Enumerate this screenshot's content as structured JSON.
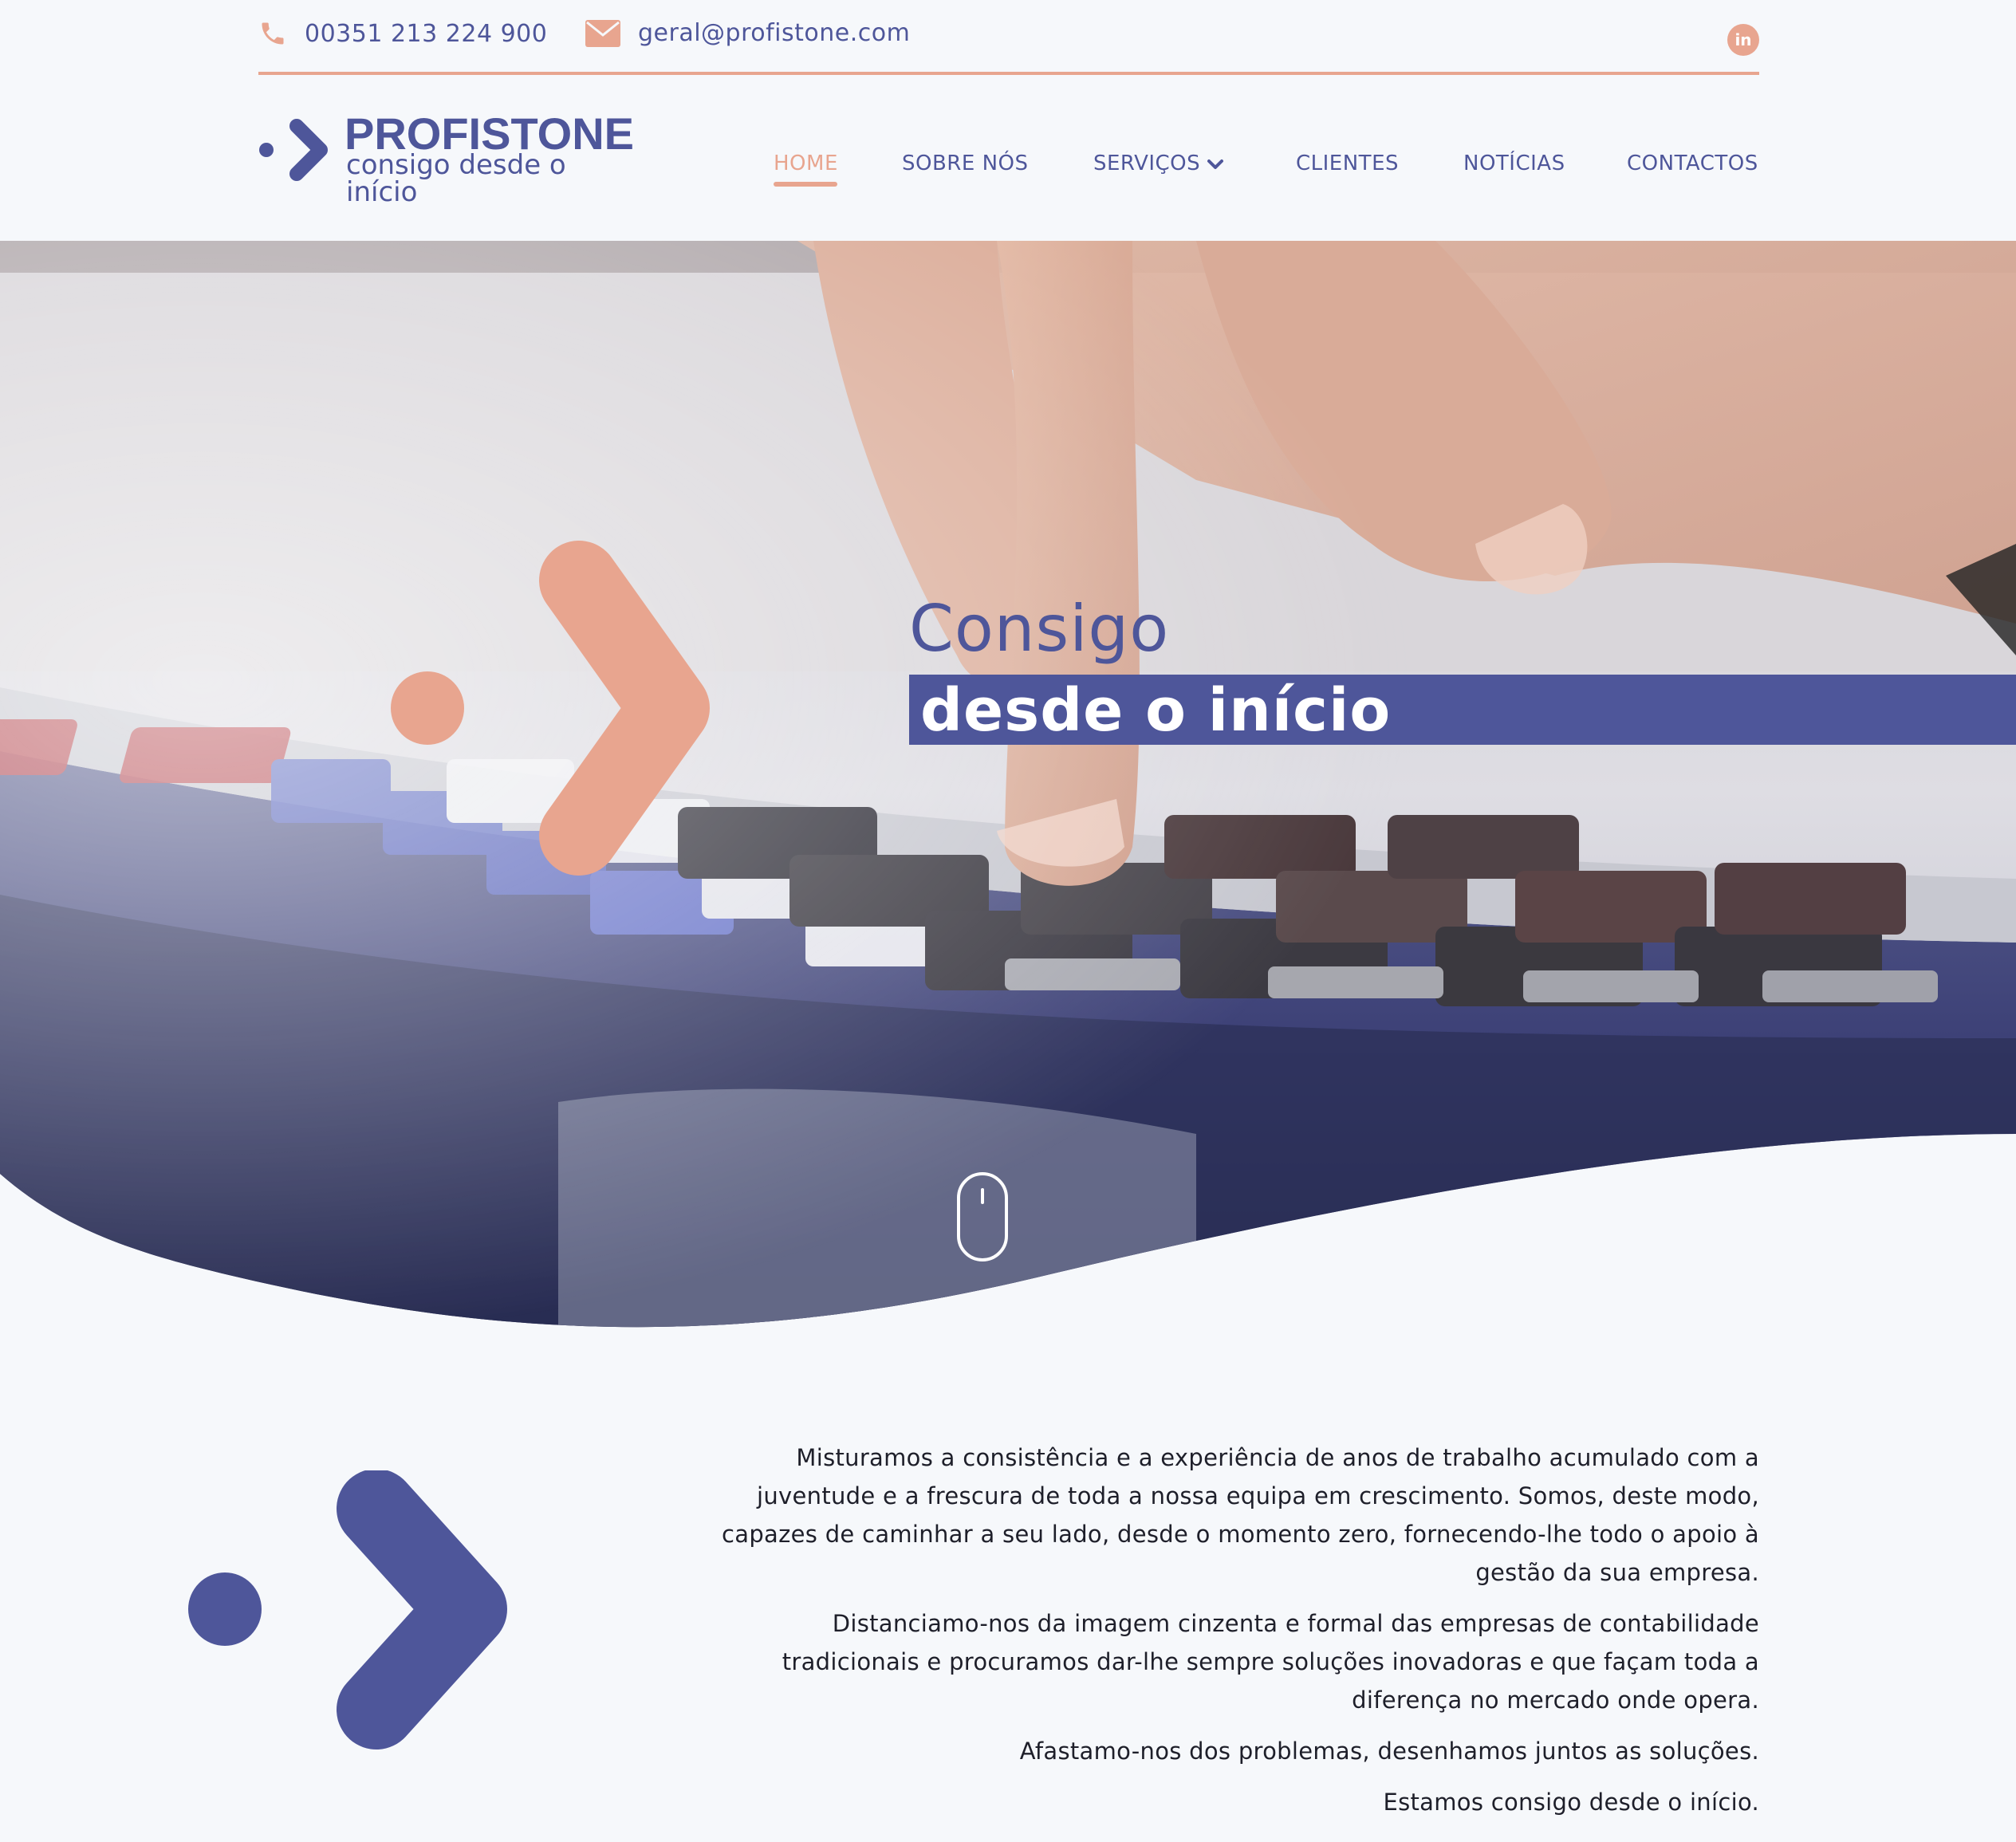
{
  "topbar": {
    "phone": "00351 213 224 900",
    "email": "geral@profistone.com",
    "social_icon": "linkedin-icon",
    "social_label": "in"
  },
  "brand": {
    "name": "PROFISTONE",
    "tagline": "consigo desde o início"
  },
  "nav": {
    "items": [
      {
        "label": "HOME",
        "active": true
      },
      {
        "label": "SOBRE NÓS",
        "active": false
      },
      {
        "label": "SERVIÇOS",
        "active": false,
        "dropdown": true
      },
      {
        "label": "CLIENTES",
        "active": false
      },
      {
        "label": "NOTÍCIAS",
        "active": false
      },
      {
        "label": "CONTACTOS",
        "active": false
      }
    ]
  },
  "hero": {
    "title_line1": "Consigo",
    "title_line2": "desde o início",
    "scroll_icon": "mouse-scroll-icon"
  },
  "about": {
    "paragraphs": [
      "Misturamos a consistência e a experiência de anos de trabalho acumulado com a juventude e a frescura de toda a nossa equipa em crescimento. Somos, deste modo, capazes de caminhar a seu lado, desde o momento zero, fornecendo-lhe todo o apoio à gestão da sua empresa.",
      "Distanciamo-nos da imagem cinzenta e formal das empresas de contabilidade tradicionais e procuramos dar-lhe sempre soluções inovadoras e que façam toda a diferença no mercado onde opera.",
      "Afastamo-nos dos problemas, desenhamos juntos as soluções.",
      "Estamos consigo desde o início."
    ]
  },
  "colors": {
    "primary": "#4e569a",
    "accent": "#e8a58f",
    "background": "#f6f8fb",
    "text": "#1e1f2a"
  }
}
